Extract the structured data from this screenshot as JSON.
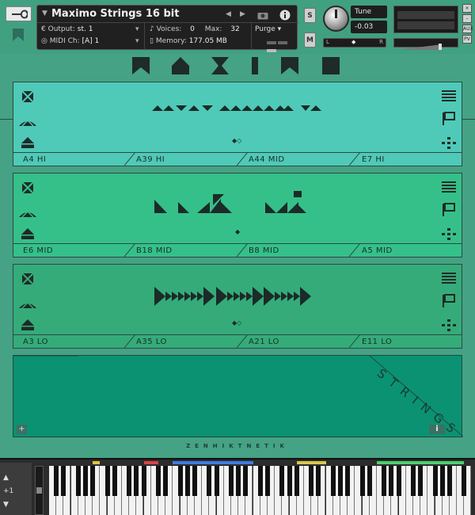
{
  "header": {
    "instrument_title": "Maximo Strings 16 bit",
    "output_label": "Output:",
    "output_value": "st. 1",
    "midi_label": "MIDI Ch:",
    "midi_value": "[A]  1",
    "voices_label": "Voices:",
    "voices_value": "0",
    "max_label": "Max:",
    "max_value": "32",
    "memory_label": "Memory:",
    "memory_value": "177.05 MB",
    "purge_label": "Purge",
    "solo_label": "S",
    "mute_label": "M",
    "tune_label": "Tune",
    "tune_value": "-0.03",
    "pan_left": "L",
    "pan_right": "R",
    "aux_label": "AUX",
    "pv_label": "PV"
  },
  "sections": [
    {
      "id": "hi",
      "slots": [
        "A4 HI",
        "A39 HI",
        "A44 MID",
        "E7 HI"
      ]
    },
    {
      "id": "mid",
      "slots": [
        "E6 MID",
        "B18 MID",
        "B8 MID",
        "A5 MID"
      ]
    },
    {
      "id": "lo",
      "slots": [
        "A3 LO",
        "A35 LO",
        "A21 LO",
        "E11 LO"
      ]
    }
  ],
  "footer": {
    "product_word": "STRINGS",
    "brand": "ZENHIKTNETIK",
    "info_label": "i",
    "add_label": "+"
  },
  "keyboard": {
    "octave_label": "+1"
  },
  "colors": {
    "section_hi": "#4fcab8",
    "section_mid": "#35c08a",
    "section_lo": "#35ab7a",
    "big_panel": "#0b9273",
    "background": "#45a284"
  }
}
